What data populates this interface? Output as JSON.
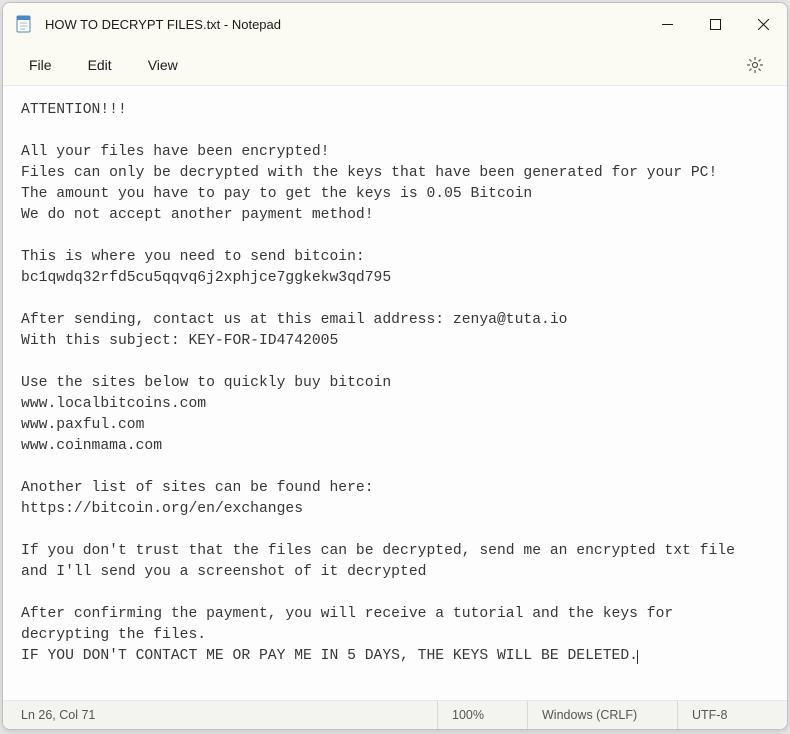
{
  "titlebar": {
    "title": "HOW TO DECRYPT FILES.txt - Notepad"
  },
  "menu": {
    "file": "File",
    "edit": "Edit",
    "view": "View"
  },
  "content": "ATTENTION!!!\n\nAll your files have been encrypted!\nFiles can only be decrypted with the keys that have been generated for your PC!\nThe amount you have to pay to get the keys is 0.05 Bitcoin\nWe do not accept another payment method!\n\nThis is where you need to send bitcoin:\nbc1qwdq32rfd5cu5qqvq6j2xphjce7ggkekw3qd795\n\nAfter sending, contact us at this email address: zenya@tuta.io\nWith this subject: KEY-FOR-ID4742005\n\nUse the sites below to quickly buy bitcoin\nwww.localbitcoins.com\nwww.paxful.com\nwww.coinmama.com\n\nAnother list of sites can be found here:\nhttps://bitcoin.org/en/exchanges\n\nIf you don't trust that the files can be decrypted, send me an encrypted txt file\nand I'll send you a screenshot of it decrypted\n\nAfter confirming the payment, you will receive a tutorial and the keys for decrypting the files.\nIF YOU DON'T CONTACT ME OR PAY ME IN 5 DAYS, THE KEYS WILL BE DELETED.",
  "statusbar": {
    "position": "Ln 26, Col 71",
    "zoom": "100%",
    "line_ending": "Windows (CRLF)",
    "encoding": "UTF-8"
  },
  "icons": {
    "notepad": "notepad-icon",
    "minimize": "minimize-icon",
    "maximize": "maximize-icon",
    "close": "close-icon",
    "settings": "gear-icon"
  }
}
